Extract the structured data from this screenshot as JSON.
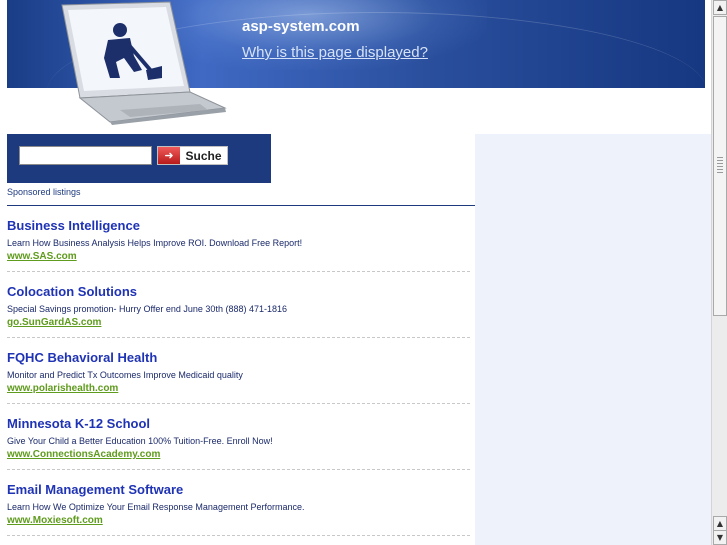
{
  "header": {
    "site_title": "asp-system.com",
    "why_link": "Why is this page displayed?"
  },
  "icons": {
    "laptop": "laptop-worker-icon",
    "search_arrow": "arrow-right-icon"
  },
  "search": {
    "value": "",
    "button_label": "Suche"
  },
  "sponsored_label": "Sponsored listings",
  "listings": [
    {
      "title": "Business Intelligence",
      "desc": "Learn How Business Analysis Helps Improve ROI. Download Free Report!",
      "url": "www.SAS.com"
    },
    {
      "title": "Colocation Solutions",
      "desc": "Special Savings promotion- Hurry Offer end June 30th (888) 471-1816",
      "url": "go.SunGardAS.com"
    },
    {
      "title": "FQHC Behavioral Health",
      "desc": "Monitor and Predict Tx Outcomes Improve Medicaid quality",
      "url": "www.polarishealth.com"
    },
    {
      "title": "Minnesota K-12 School",
      "desc": "Give Your Child a Better Education 100% Tuition-Free. Enroll Now!",
      "url": "www.ConnectionsAcademy.com"
    },
    {
      "title": "Email Management Software",
      "desc": "Learn How We Optimize Your Email Response Management Performance.",
      "url": "www.Moxiesoft.com"
    }
  ],
  "colors": {
    "header": "#2a4f9d",
    "title_link": "#1f33b5",
    "url": "#5f9b1d",
    "panel": "#eef3fb"
  }
}
